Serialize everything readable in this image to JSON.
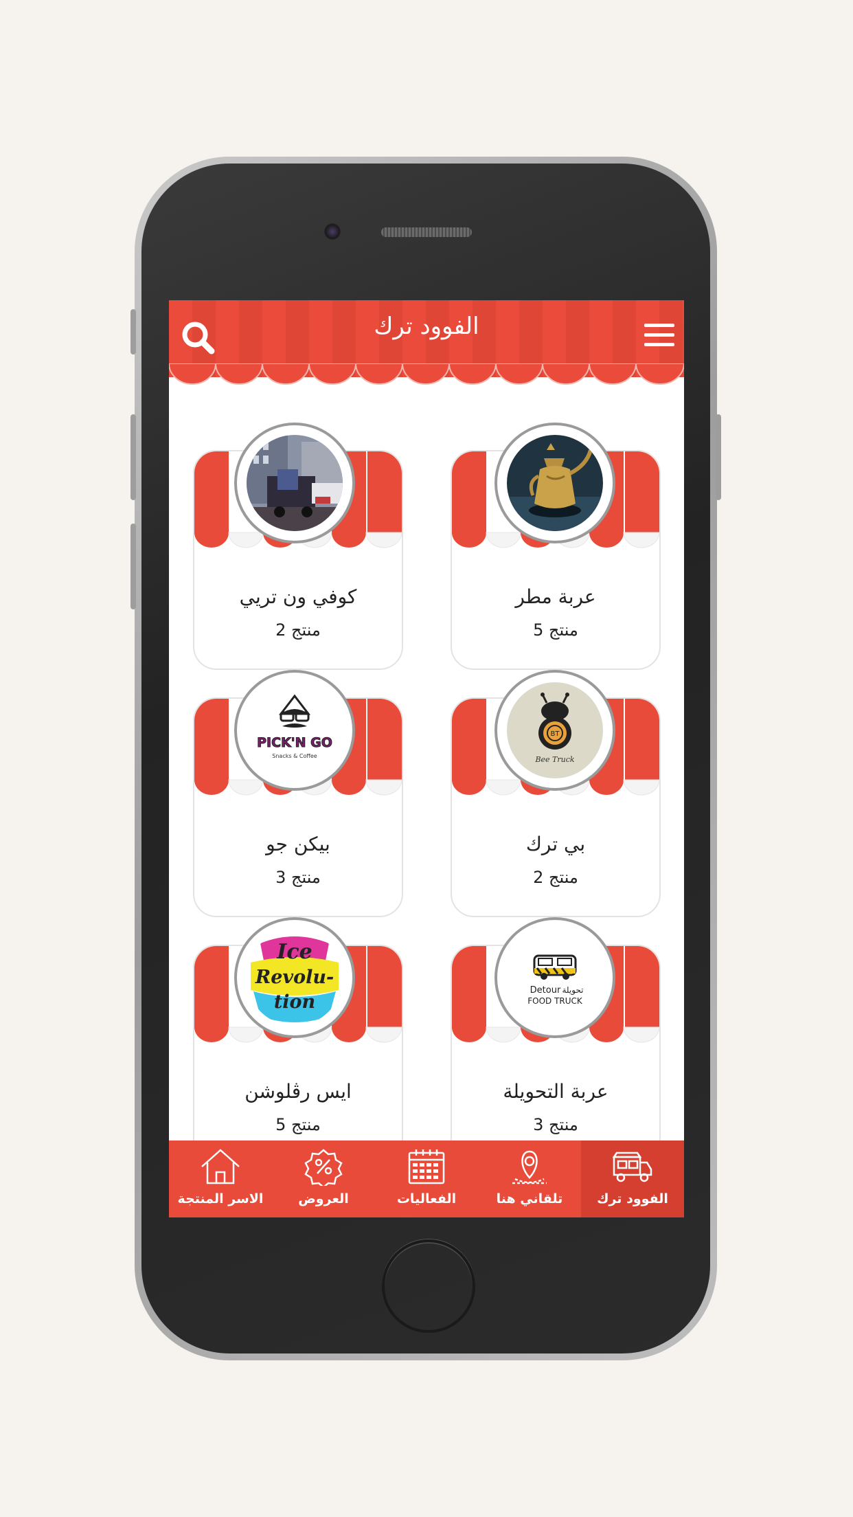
{
  "header": {
    "title": "الفوود ترك",
    "search_icon": "search-icon",
    "menu_icon": "hamburger-menu-icon"
  },
  "colors": {
    "primary": "#e84b3a",
    "primary_dark": "#d53f30",
    "awning_white": "#ffffff",
    "background": "#f6f3ee"
  },
  "trucks": [
    {
      "name": "عربة مطر",
      "count": "5 منتج",
      "logo": "dallah-coffee-pot-photo"
    },
    {
      "name": "كوفي ون تريي",
      "count": "2 منتج",
      "logo": "street-truck-photo"
    },
    {
      "name": "بي ترك",
      "count": "2 منتج",
      "logo": "bee-truck-logo"
    },
    {
      "name": "بيكن جو",
      "count": "3 منتج",
      "logo": "pick-n-go-logo"
    },
    {
      "name": "عربة التحويلة",
      "count": "3 منتج",
      "logo": "detour-food-truck-logo"
    },
    {
      "name": "ايس رڤلوشن",
      "count": "5 منتج",
      "logo": "ice-revolution-logo"
    }
  ],
  "logo_text": {
    "bee": "Bee Truck",
    "bee_badge": "BT",
    "pickngo": "PICK'N GO",
    "pickngo_sub": "Snacks & Coffee",
    "detour_en": "Detour",
    "detour_ar": "تحويلة",
    "detour_sub": "FOOD TRUCK",
    "ice1": "Ice",
    "ice2": "Revolu-",
    "ice3": "tion"
  },
  "tabs": [
    {
      "label": "الفوود ترك",
      "icon": "food-truck-icon",
      "active": true
    },
    {
      "label": "تلقاني هنا",
      "icon": "location-pin-icon",
      "active": false
    },
    {
      "label": "الفعاليات",
      "icon": "calendar-icon",
      "active": false
    },
    {
      "label": "العروض",
      "icon": "discount-badge-icon",
      "active": false
    },
    {
      "label": "الاسر المنتجة",
      "icon": "home-icon",
      "active": false
    }
  ]
}
